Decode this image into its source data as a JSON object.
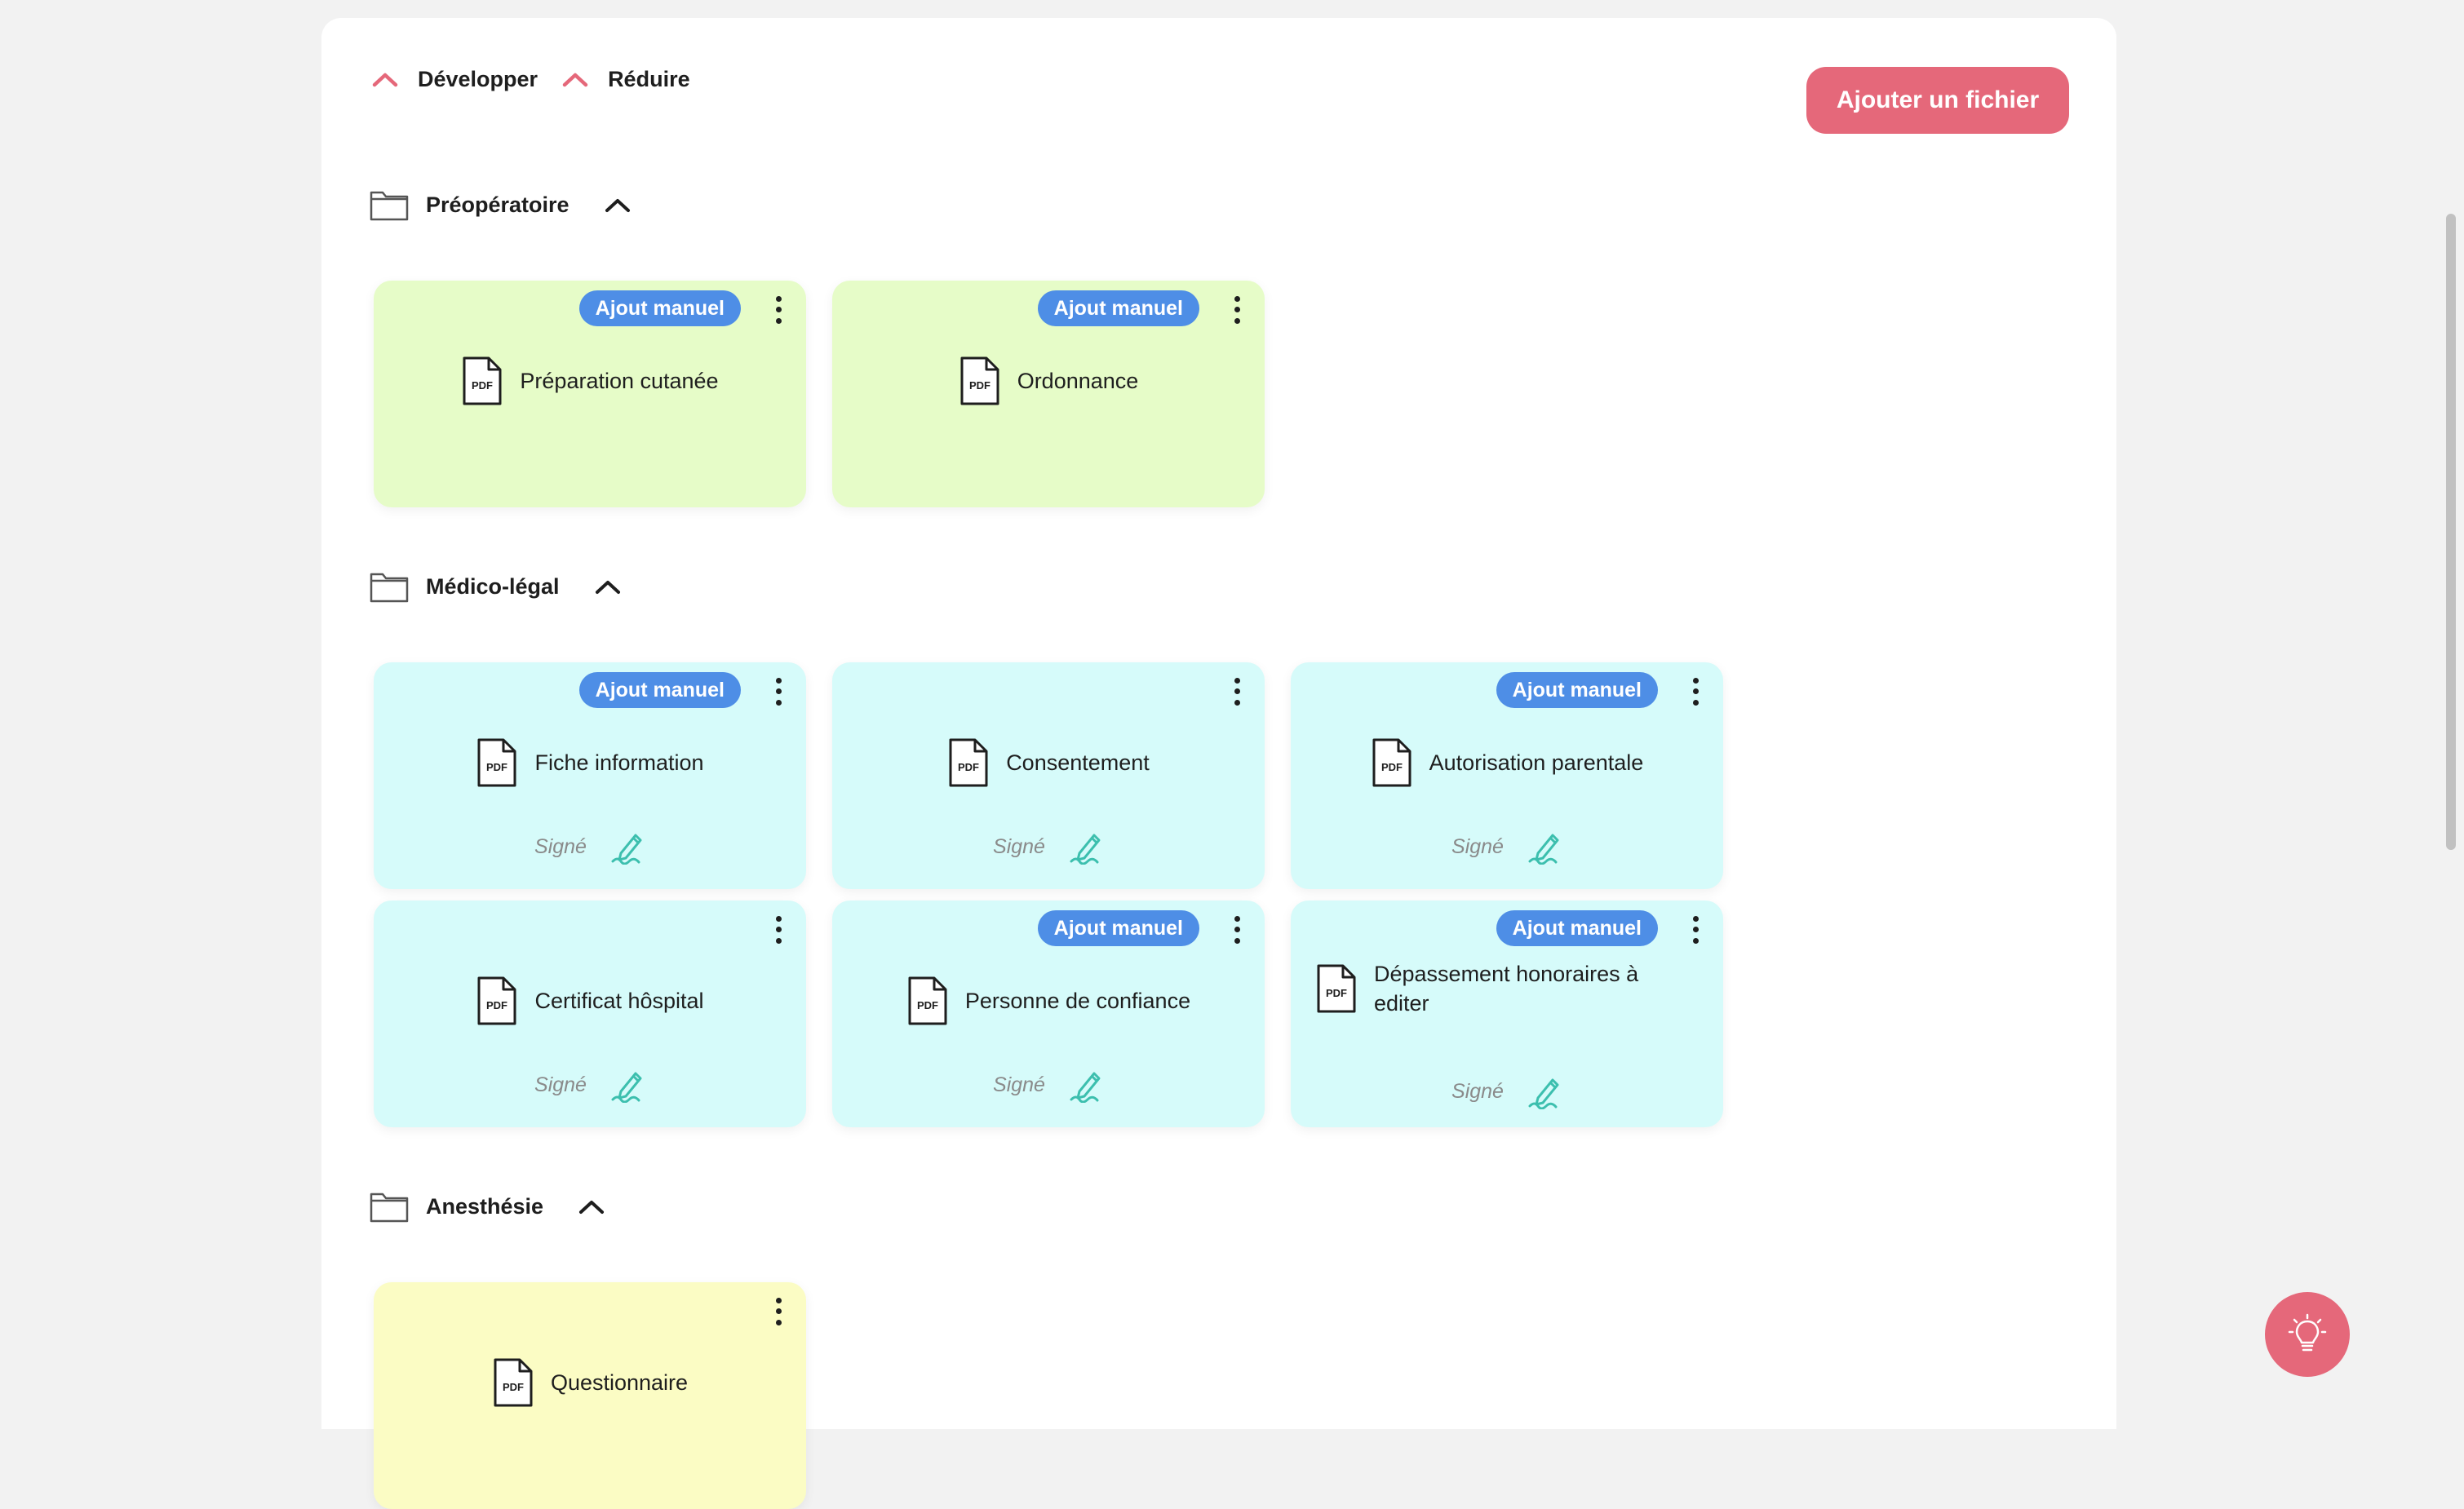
{
  "toolbar": {
    "expand_label": "Développer",
    "collapse_label": "Réduire",
    "add_file_label": "Ajouter un fichier"
  },
  "sections": [
    {
      "title": "Préopératoire",
      "color": "#e6fcc8",
      "files": [
        {
          "name": "Préparation cutanée",
          "badge": "Ajout manuel"
        },
        {
          "name": "Ordonnance",
          "badge": "Ajout manuel"
        }
      ]
    },
    {
      "title": "Médico-légal",
      "color": "#d6fbfa",
      "files": [
        {
          "name": "Fiche information",
          "badge": "Ajout manuel",
          "status": "Signé"
        },
        {
          "name": "Consentement",
          "status": "Signé"
        },
        {
          "name": "Autorisation parentale",
          "badge": "Ajout manuel",
          "status": "Signé"
        },
        {
          "name": "Certificat hôspital",
          "status": "Signé"
        },
        {
          "name": "Personne de confiance",
          "badge": "Ajout manuel",
          "status": "Signé"
        },
        {
          "name": "Dépassement honoraires à editer",
          "badge": "Ajout manuel",
          "status": "Signé"
        }
      ]
    },
    {
      "title": "Anesthésie",
      "color": "#fbfcc4",
      "files": [
        {
          "name": "Questionnaire"
        }
      ]
    }
  ],
  "icons": {
    "pdf_label": "PDF",
    "folder": "folder-icon",
    "pdf": "pdf-file-icon",
    "signature": "signature-pen-icon",
    "more": "kebab-menu-icon",
    "help": "lightbulb-icon"
  },
  "colors": {
    "accent": "#e5687a",
    "badge": "#4e8ee6",
    "signature": "#3cbfae"
  }
}
